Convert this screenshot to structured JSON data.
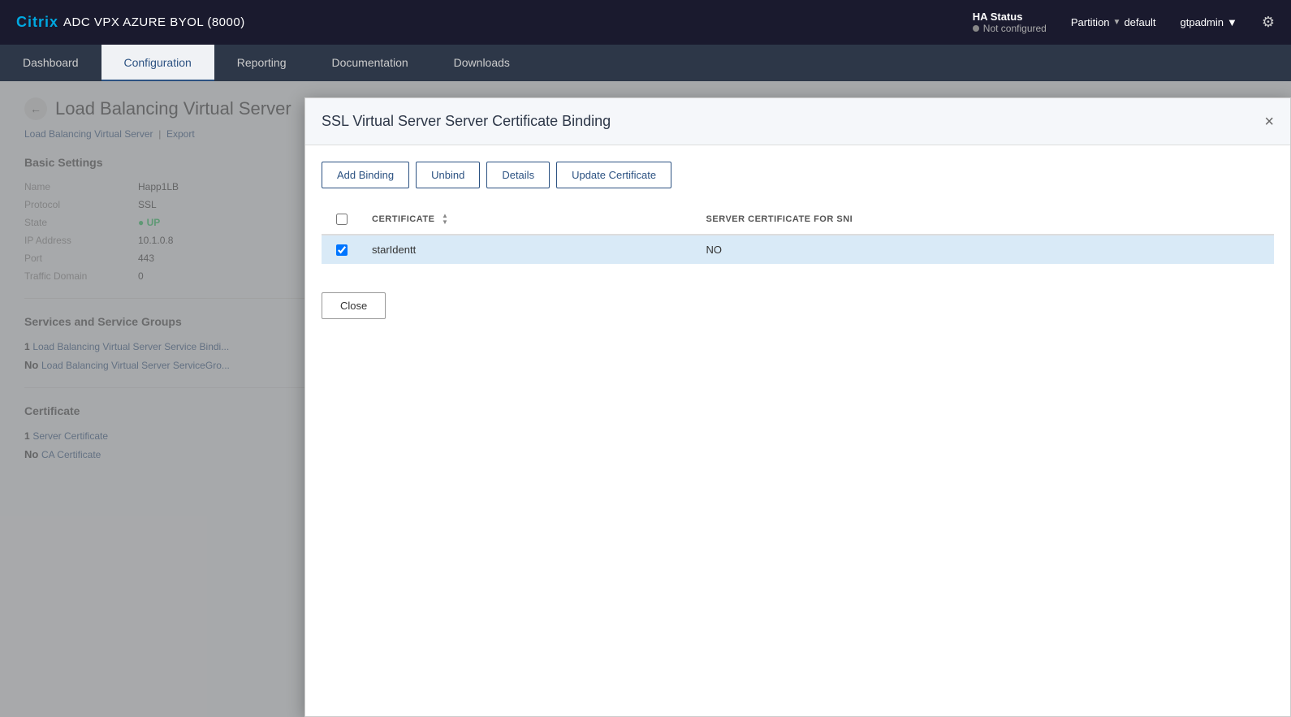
{
  "topbar": {
    "brand_citrix": "Citrix",
    "app_name": "ADC VPX AZURE BYOL (8000)",
    "ha_status_label": "HA Status",
    "ha_status_value": "Not configured",
    "partition_label": "Partition",
    "partition_value": "default",
    "user": "gtpadmin"
  },
  "nav": {
    "tabs": [
      {
        "id": "dashboard",
        "label": "Dashboard"
      },
      {
        "id": "configuration",
        "label": "Configuration",
        "active": true
      },
      {
        "id": "reporting",
        "label": "Reporting"
      },
      {
        "id": "documentation",
        "label": "Documentation"
      },
      {
        "id": "downloads",
        "label": "Downloads"
      }
    ]
  },
  "bg_page": {
    "title": "Load Balancing Virtual Server",
    "breadcrumb_link": "Load Balancing Virtual Server",
    "breadcrumb_action": "Export",
    "basic_settings_title": "Basic Settings",
    "fields": [
      {
        "label": "Name",
        "value": "Happ1LB"
      },
      {
        "label": "Protocol",
        "value": "SSL"
      },
      {
        "label": "State",
        "value": "UP"
      },
      {
        "label": "IP Address",
        "value": "10.1.0.8"
      },
      {
        "label": "Port",
        "value": "443"
      },
      {
        "label": "Traffic Domain",
        "value": "0"
      }
    ],
    "services_title": "Services and Service Groups",
    "service_binding_count": "1",
    "service_binding_label": "Load Balancing Virtual Server Service Bindi...",
    "service_group_count": "No",
    "service_group_label": "Load Balancing Virtual Server ServiceGro...",
    "certificate_title": "Certificate",
    "cert_server_count": "1",
    "cert_server_label": "Server Certificate",
    "cert_ca_count": "No",
    "cert_ca_label": "CA Certificate"
  },
  "modal": {
    "title": "SSL Virtual Server Server Certificate Binding",
    "close_label": "×",
    "buttons": {
      "add_binding": "Add Binding",
      "unbind": "Unbind",
      "details": "Details",
      "update_certificate": "Update Certificate"
    },
    "table": {
      "columns": [
        {
          "id": "checkbox",
          "label": ""
        },
        {
          "id": "certificate",
          "label": "CERTIFICATE"
        },
        {
          "id": "sni",
          "label": "SERVER CERTIFICATE FOR SNI"
        }
      ],
      "rows": [
        {
          "selected": true,
          "certificate": "starIdentt",
          "sni": "NO"
        }
      ]
    },
    "close_button": "Close"
  }
}
